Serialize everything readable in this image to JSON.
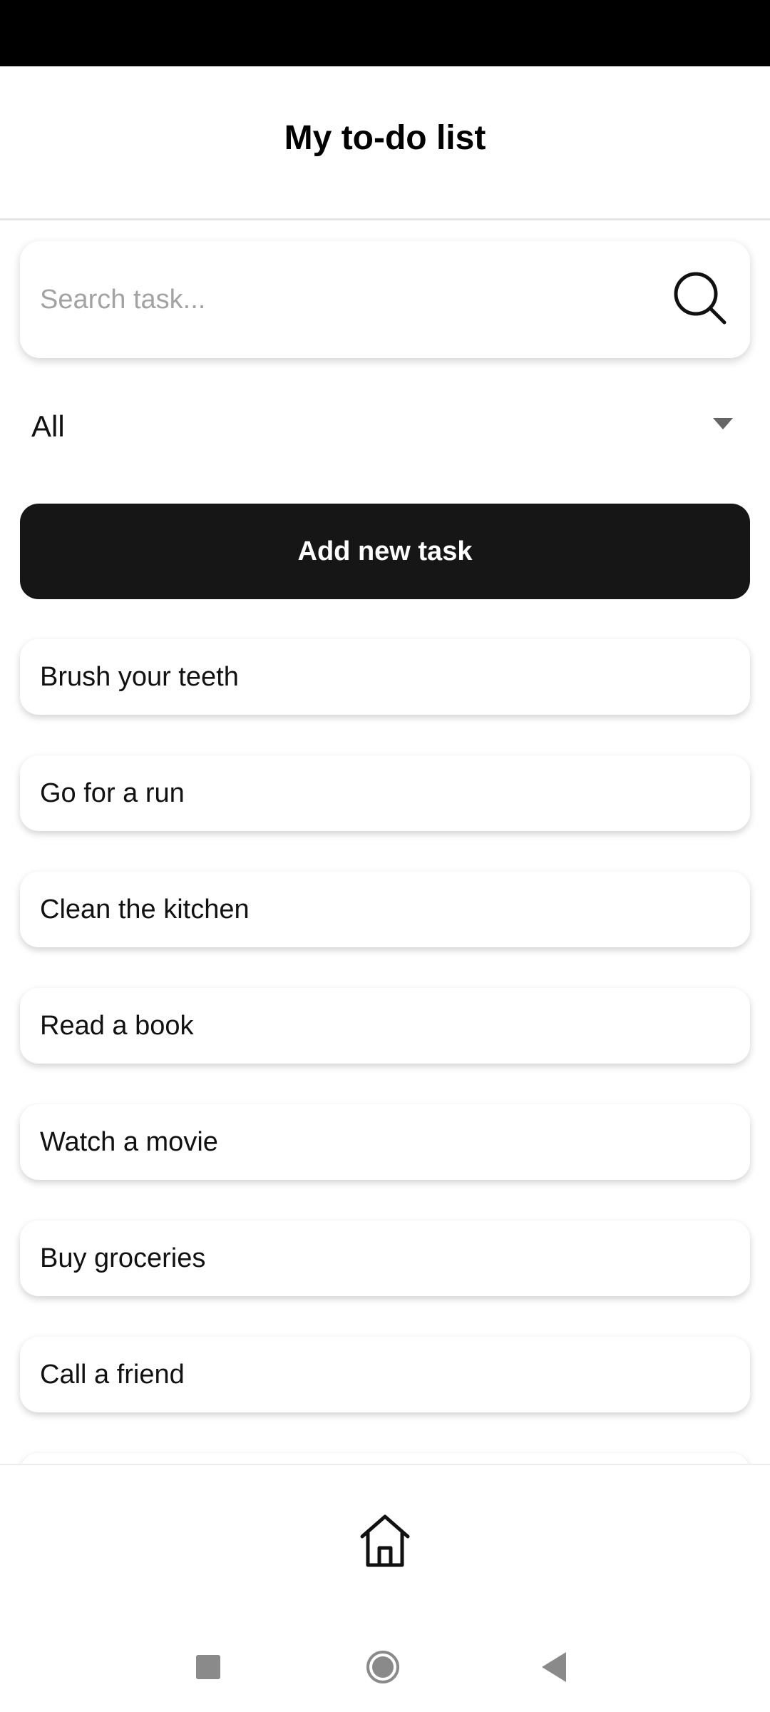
{
  "header": {
    "title": "My to-do list"
  },
  "search": {
    "placeholder": "Search task...",
    "value": ""
  },
  "filter": {
    "selected": "All"
  },
  "actions": {
    "add_task_label": "Add new task"
  },
  "tasks": [
    {
      "label": "Brush your teeth"
    },
    {
      "label": "Go for a run"
    },
    {
      "label": "Clean the kitchen"
    },
    {
      "label": "Read a book"
    },
    {
      "label": "Watch a movie"
    },
    {
      "label": "Buy groceries"
    },
    {
      "label": "Call a friend"
    }
  ],
  "bottom_nav": {
    "items": [
      {
        "icon": "home-icon"
      }
    ]
  },
  "system_nav": {
    "icons": [
      "recent-apps-icon",
      "home-circle-icon",
      "back-icon"
    ]
  },
  "colors": {
    "status_bar": "#000000",
    "primary_button": "#161616",
    "placeholder": "#a3a3a3",
    "system_icons": "#8a8a8a"
  }
}
